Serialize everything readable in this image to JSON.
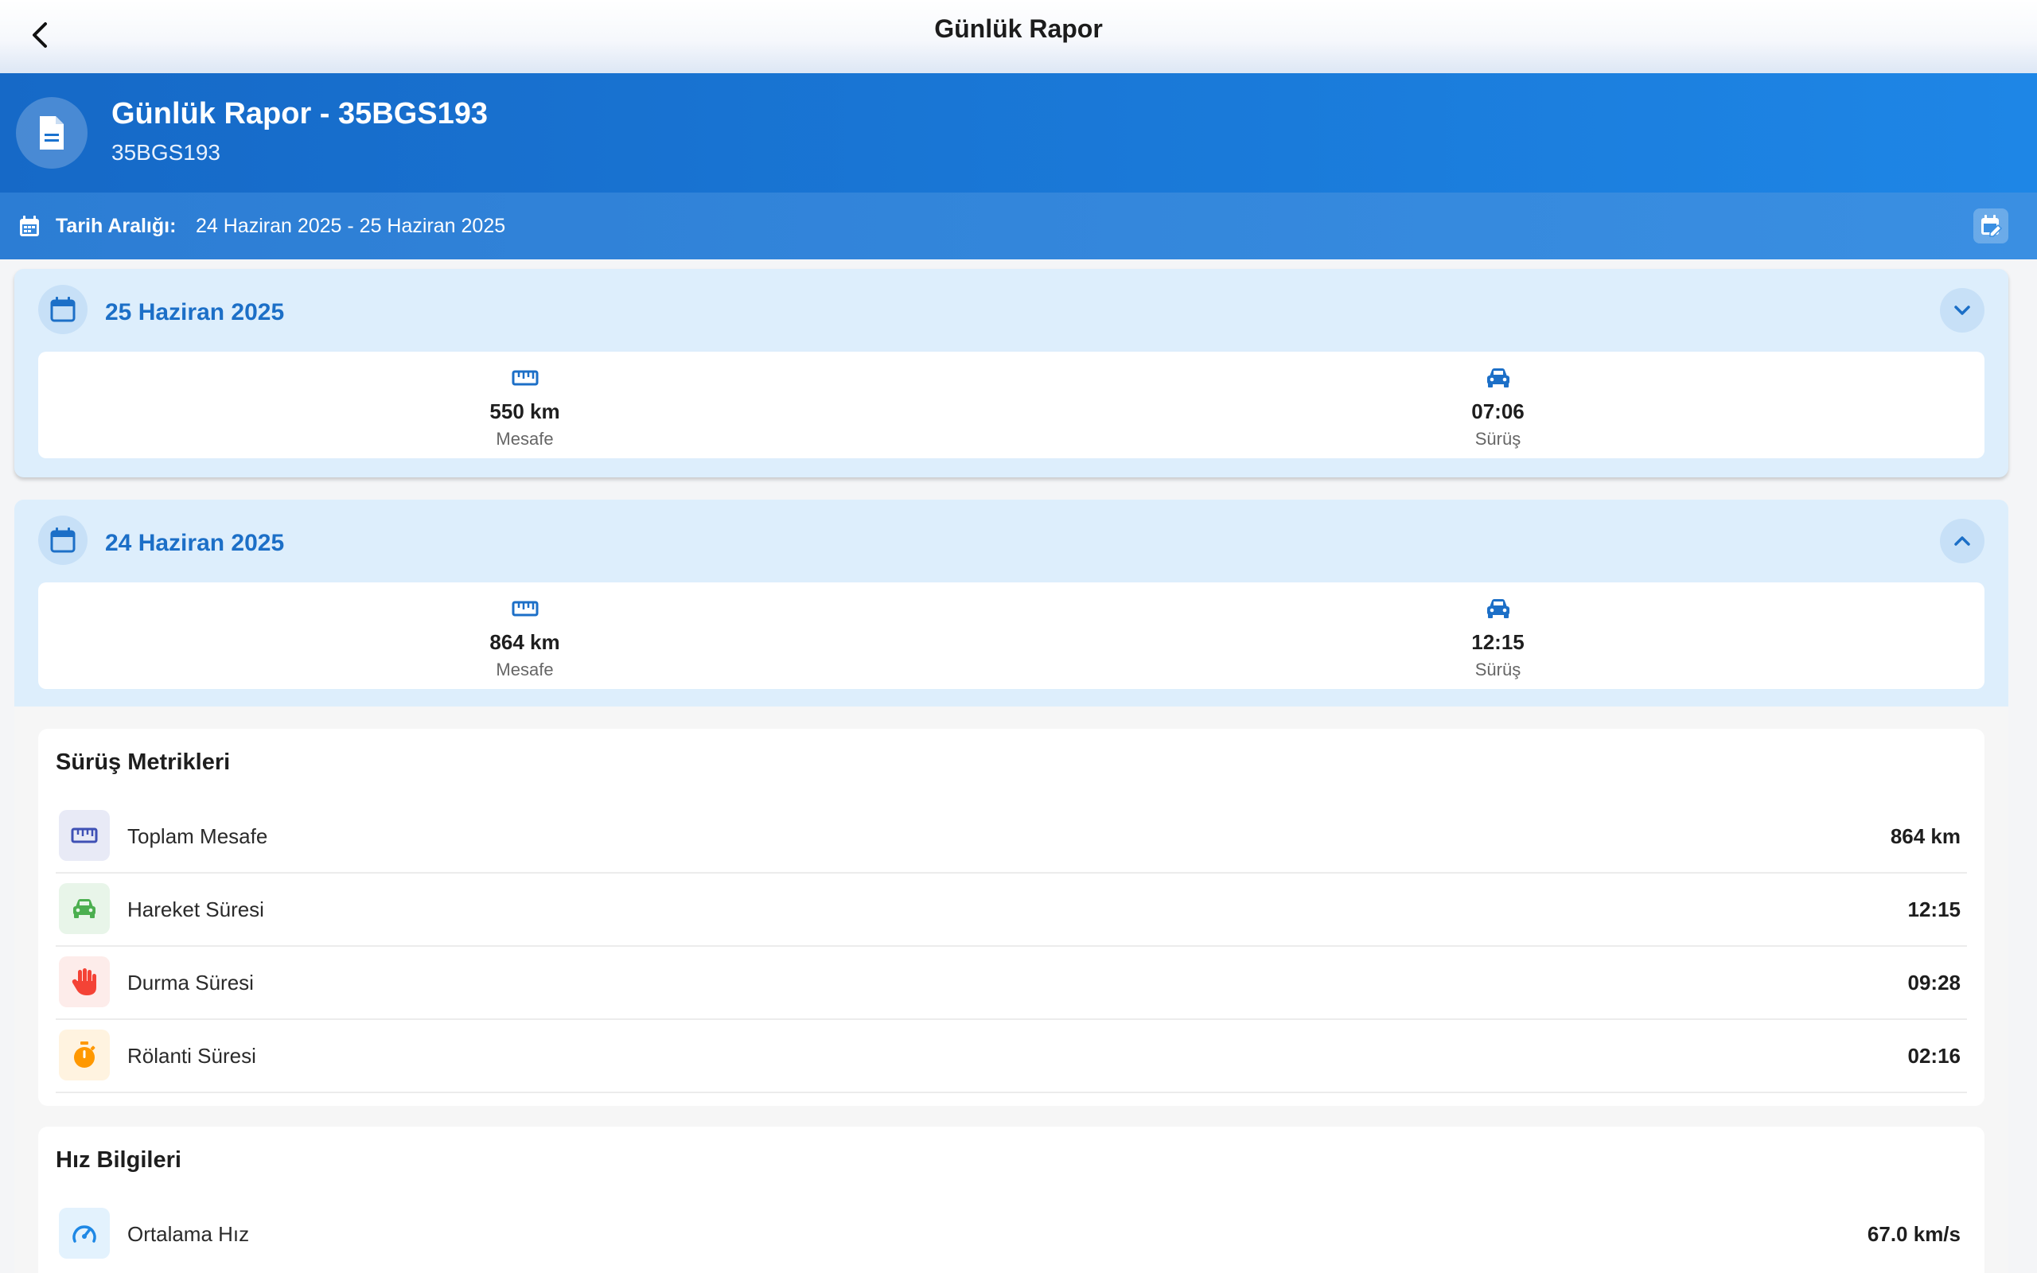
{
  "appbar": {
    "title": "Günlük Rapor"
  },
  "header": {
    "title": "Günlük Rapor - 35BGS193",
    "subtitle": "35BGS193"
  },
  "range": {
    "label": "Tarih Aralığı:",
    "value": "24 Haziran 2025 - 25 Haziran 2025"
  },
  "days": [
    {
      "date": "25 Haziran 2025",
      "expanded": false,
      "distance": {
        "value": "550 km",
        "label": "Mesafe"
      },
      "driving": {
        "value": "07:06",
        "label": "Sürüş"
      }
    },
    {
      "date": "24 Haziran 2025",
      "expanded": true,
      "distance": {
        "value": "864 km",
        "label": "Mesafe"
      },
      "driving": {
        "value": "12:15",
        "label": "Sürüş"
      }
    }
  ],
  "driving_metrics": {
    "title": "Sürüş Metrikleri",
    "rows": [
      {
        "label": "Toplam Mesafe",
        "value": "864 km",
        "icon": "ruler-icon",
        "color": "#3f51b5",
        "bg": "#e8eaf6"
      },
      {
        "label": "Hareket Süresi",
        "value": "12:15",
        "icon": "car-icon",
        "color": "#4caf50",
        "bg": "#e8f5e9"
      },
      {
        "label": "Durma Süresi",
        "value": "09:28",
        "icon": "hand-icon",
        "color": "#f44336",
        "bg": "#fdecea"
      },
      {
        "label": "Rölanti Süresi",
        "value": "02:16",
        "icon": "timer-icon",
        "color": "#ff9800",
        "bg": "#fff3e0"
      }
    ]
  },
  "speed_info": {
    "title": "Hız Bilgileri",
    "rows": [
      {
        "label": "Ortalama Hız",
        "value": "67.0 km/s",
        "icon": "speedometer-icon",
        "color": "#1e88e5",
        "bg": "#e3f2fd"
      }
    ]
  }
}
